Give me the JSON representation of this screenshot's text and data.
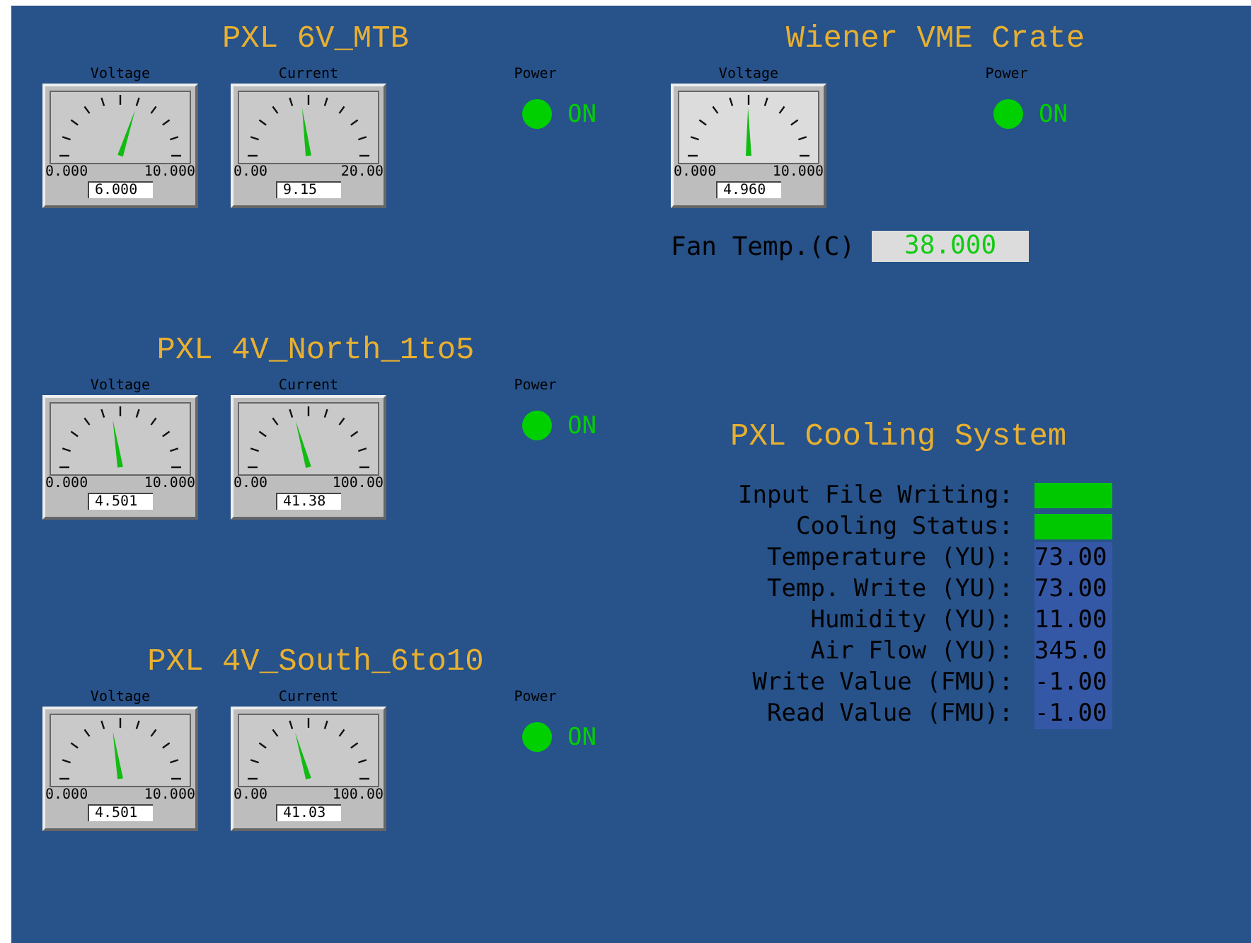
{
  "panels": [
    {
      "title": "PXL 6V_MTB",
      "meters": [
        {
          "label": "Voltage",
          "min": "0.000",
          "max": "10.000",
          "reading": "6.000",
          "level": 0.6
        },
        {
          "label": "Current",
          "min": "0.00",
          "max": "20.00",
          "reading": "9.15",
          "level": 0.4575
        }
      ],
      "power": {
        "label": "Power",
        "on": true,
        "state": "ON"
      }
    },
    {
      "title": "PXL 4V_North_1to5",
      "meters": [
        {
          "label": "Voltage",
          "min": "0.000",
          "max": "10.000",
          "reading": "4.501",
          "level": 0.4501
        },
        {
          "label": "Current",
          "min": "0.00",
          "max": "100.00",
          "reading": "41.38",
          "level": 0.4138
        }
      ],
      "power": {
        "label": "Power",
        "on": true,
        "state": "ON"
      }
    },
    {
      "title": "PXL 4V_South_6to10",
      "meters": [
        {
          "label": "Voltage",
          "min": "0.000",
          "max": "10.000",
          "reading": "4.501",
          "level": 0.4501
        },
        {
          "label": "Current",
          "min": "0.00",
          "max": "100.00",
          "reading": "41.03",
          "level": 0.4103
        }
      ],
      "power": {
        "label": "Power",
        "on": true,
        "state": "ON"
      }
    }
  ],
  "crate": {
    "title": "Wiener VME Crate",
    "meters": [
      {
        "label": "Voltage",
        "min": "0.000",
        "max": "10.000",
        "reading": "4.960",
        "level": 0.496
      }
    ],
    "power": {
      "label": "Power",
      "on": true,
      "state": "ON"
    },
    "fan_temp": {
      "label": "Fan Temp.(C)",
      "value": "38.000"
    }
  },
  "cooling": {
    "title": "PXL Cooling System",
    "rows": [
      {
        "label": "Input File Writing:",
        "kind": "status",
        "on": true
      },
      {
        "label": "Cooling Status:",
        "kind": "status",
        "on": true
      },
      {
        "label": "Temperature (YU):",
        "kind": "value",
        "value": "73.00"
      },
      {
        "label": "Temp. Write (YU):",
        "kind": "value",
        "value": "73.00"
      },
      {
        "label": "Humidity (YU):",
        "kind": "value",
        "value": "11.00"
      },
      {
        "label": "Air Flow (YU):",
        "kind": "value",
        "value": "345.0"
      },
      {
        "label": "Write Value (FMU):",
        "kind": "value",
        "value": "-1.00"
      },
      {
        "label": "Read Value (FMU):",
        "kind": "value",
        "value": "-1.00"
      }
    ]
  }
}
